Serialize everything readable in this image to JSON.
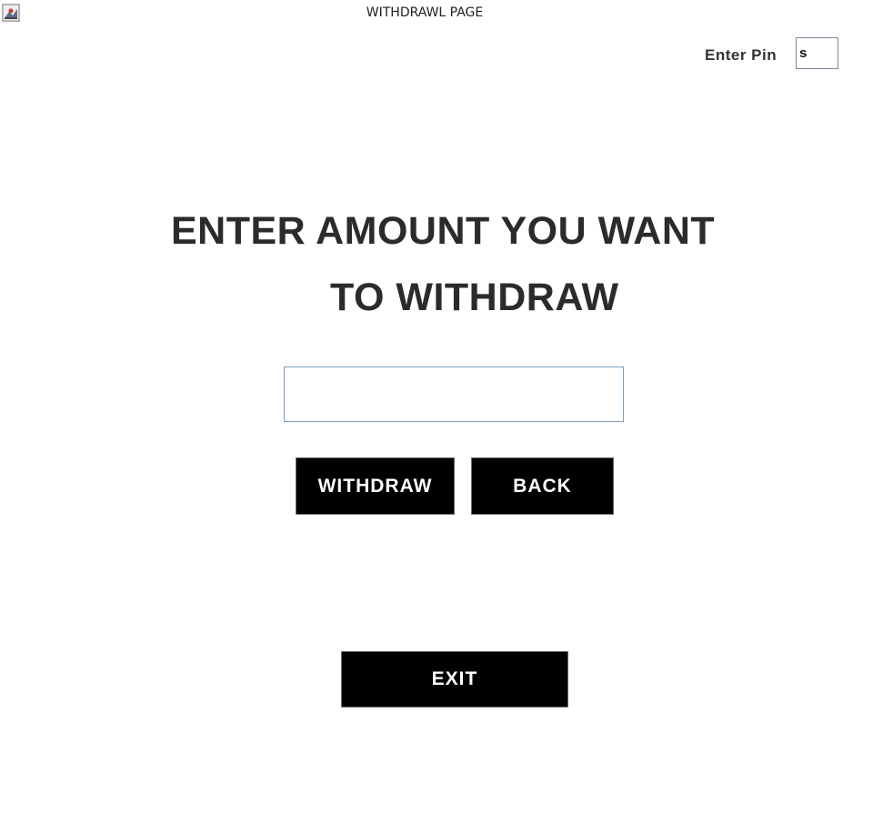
{
  "window": {
    "title": "WITHDRAWL PAGE",
    "icon": "java-app-icon"
  },
  "pin": {
    "label": "Enter Pin",
    "value": "s"
  },
  "heading": {
    "line1": "ENTER AMOUNT YOU WANT",
    "line2": "TO WITHDRAW"
  },
  "amount": {
    "value": ""
  },
  "buttons": {
    "withdraw": "WITHDRAW",
    "back": "BACK",
    "exit": "EXIT"
  },
  "colors": {
    "button_bg": "#000000",
    "button_text": "#ffffff",
    "heading_text": "#2b2b2b"
  }
}
